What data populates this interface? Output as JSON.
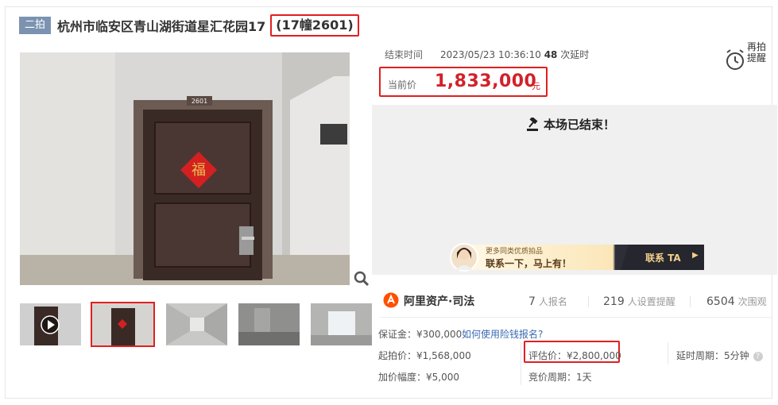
{
  "title": {
    "badge": "二拍",
    "text": "杭州市临安区青山湖街道星汇花园17",
    "boxed": "(17幢2601)"
  },
  "photo": {
    "door_number": "2601"
  },
  "auction": {
    "end_label": "结束时间",
    "end_time": "2023/05/23 10:36:10",
    "delay_count": "48",
    "delay_suffix": "次延时",
    "remind_label": "再拍提醒",
    "price_label": "当前价",
    "price_value": "1,833,000",
    "price_unit": "元",
    "ended_text": "本场已结束！"
  },
  "ad": {
    "line1": "更多同类优质拍品",
    "line2": "联系一下，马上有！",
    "button": "联系 TA"
  },
  "brand": {
    "name": "阿里资产·司法"
  },
  "stats": [
    {
      "num": "7",
      "label": "人报名"
    },
    {
      "num": "219",
      "label": "人设置提醒"
    },
    {
      "num": "6504",
      "label": "次围观"
    }
  ],
  "fields": {
    "deposit": "保证金：¥300,000",
    "deposit_link": "如何使用险钱报名?",
    "start_price": "起拍价：¥1,568,000",
    "eval_price": "评估价：¥2,800,000",
    "delay_period": "延时周期：5分钟",
    "increment": "加价幅度：¥5,000",
    "bid_period": "竞价周期：1天"
  },
  "colors": {
    "accent_red": "#e02020",
    "price_red": "#d2212a",
    "badge": "#7b93b1",
    "brand": "#ff5000"
  }
}
